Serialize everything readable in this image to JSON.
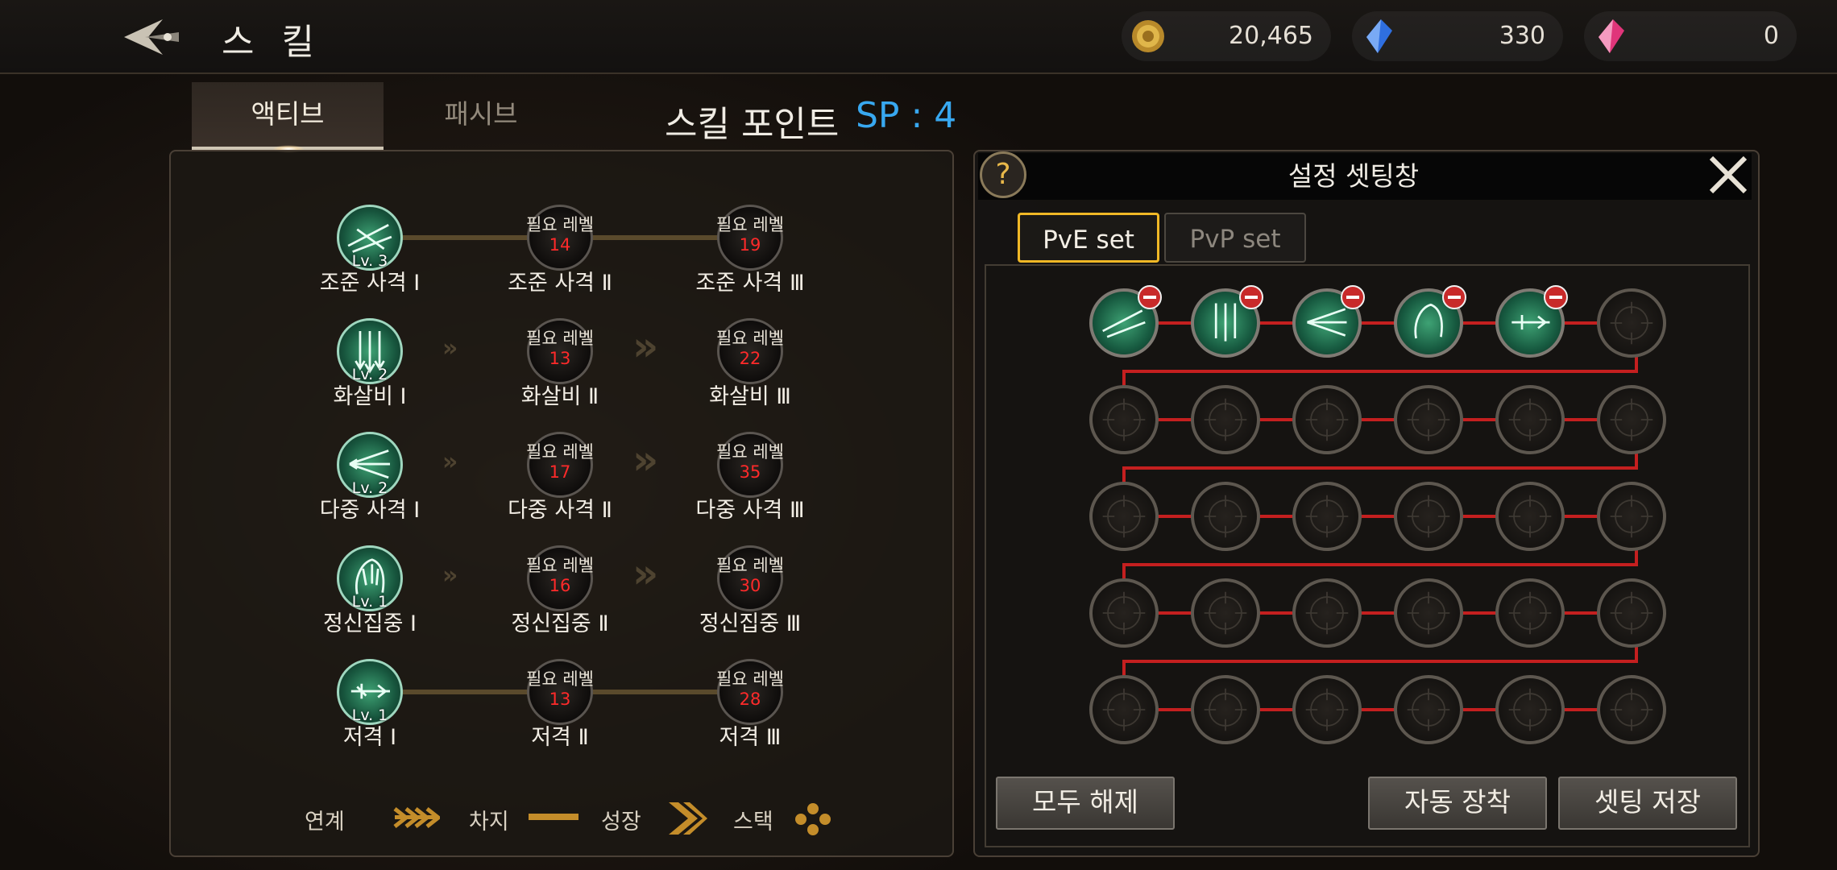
{
  "header": {
    "title": "스 킬",
    "currencies": [
      {
        "name": "gold-coin-icon",
        "value": "20,465",
        "color": "#d8a835"
      },
      {
        "name": "blue-crystal-icon",
        "value": "330",
        "color": "#2f6fe0"
      },
      {
        "name": "pink-gem-icon",
        "value": "0",
        "color": "#e0357a"
      }
    ]
  },
  "tabs": {
    "active": "액티브",
    "passive": "패시브"
  },
  "skill_points": {
    "label": "스킬 포인트",
    "value": "SP : 4"
  },
  "skill_tree": {
    "req_label": "필요 레벨",
    "rows": [
      {
        "names": [
          "조준 사격 Ⅰ",
          "조준 사격 Ⅱ",
          "조준 사격 Ⅲ"
        ],
        "level": "Lv. 3",
        "req": [
          "14",
          "19"
        ],
        "link": "charge"
      },
      {
        "names": [
          "화살비 Ⅰ",
          "화살비 Ⅱ",
          "화살비 Ⅲ"
        ],
        "level": "Lv. 2",
        "req": [
          "13",
          "22"
        ],
        "link": "growth"
      },
      {
        "names": [
          "다중 사격 Ⅰ",
          "다중 사격 Ⅱ",
          "다중 사격 Ⅲ"
        ],
        "level": "Lv. 2",
        "req": [
          "17",
          "35"
        ],
        "link": "growth"
      },
      {
        "names": [
          "정신집중 Ⅰ",
          "정신집중 Ⅱ",
          "정신집중 Ⅲ"
        ],
        "level": "Lv. 1",
        "req": [
          "16",
          "30"
        ],
        "link": "growth"
      },
      {
        "names": [
          "저격 Ⅰ",
          "저격 Ⅱ",
          "저격 Ⅲ"
        ],
        "level": "Lv. 1",
        "req": [
          "13",
          "28"
        ],
        "link": "charge"
      }
    ]
  },
  "legend": {
    "link": "연계",
    "charge": "차지",
    "growth": "성장",
    "stack": "스택"
  },
  "settings_panel": {
    "title": "설정 셋팅창",
    "help": "?",
    "set_tabs": {
      "pve": "PvE set",
      "pvp": "PvP set"
    },
    "filled_slots": 5,
    "total_slots": 30,
    "buttons": {
      "clear_all": "모두 해제",
      "auto_equip": "자동 장착",
      "save_setting": "셋팅 저장"
    }
  }
}
